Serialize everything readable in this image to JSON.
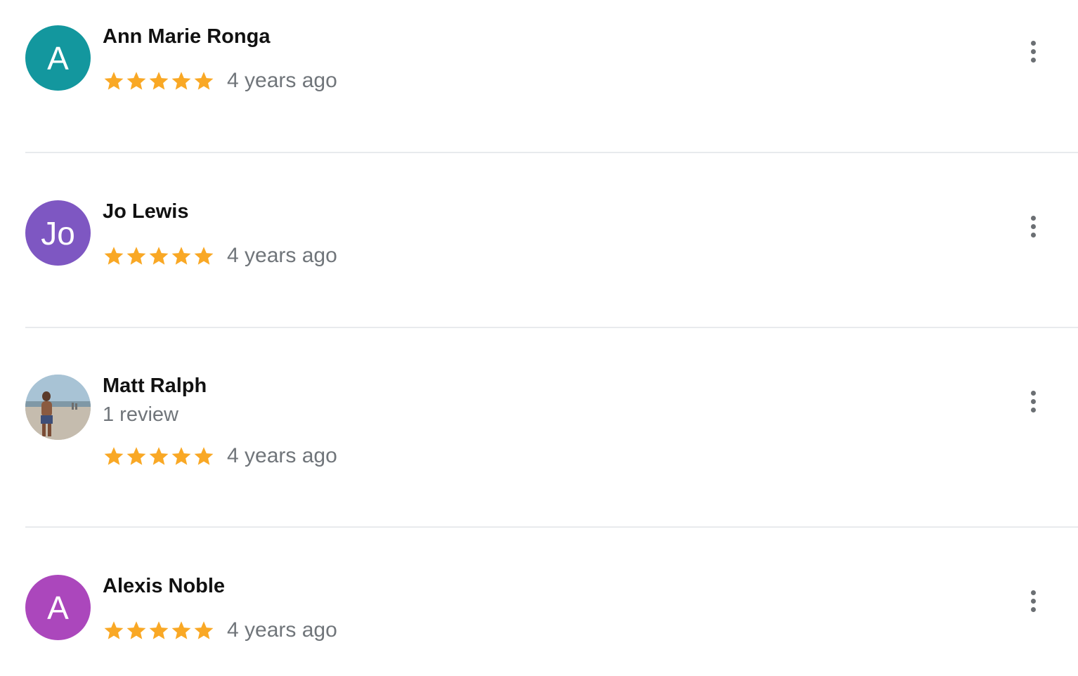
{
  "reviews": [
    {
      "name": "Ann Marie Ronga",
      "avatar_initial": "A",
      "avatar_color": "#13979e",
      "rating": 5,
      "date": "4 years ago",
      "more_icon": "more-vert-icon"
    },
    {
      "name": "Jo Lewis",
      "avatar_initial": "Jo",
      "avatar_color": "#7e57c2",
      "rating": 5,
      "date": "4 years ago",
      "more_icon": "more-vert-icon"
    },
    {
      "name": "Matt Ralph",
      "review_count": "1 review",
      "avatar_type": "photo",
      "rating": 5,
      "date": "4 years ago",
      "more_icon": "more-vert-icon"
    },
    {
      "name": "Alexis Noble",
      "avatar_initial": "A",
      "avatar_color": "#ab47bc",
      "rating": 5,
      "date": "4 years ago",
      "more_icon": "more-vert-icon"
    }
  ],
  "colors": {
    "star": "#f9a825",
    "secondary_text": "#70757a",
    "divider": "#e8eaed"
  }
}
